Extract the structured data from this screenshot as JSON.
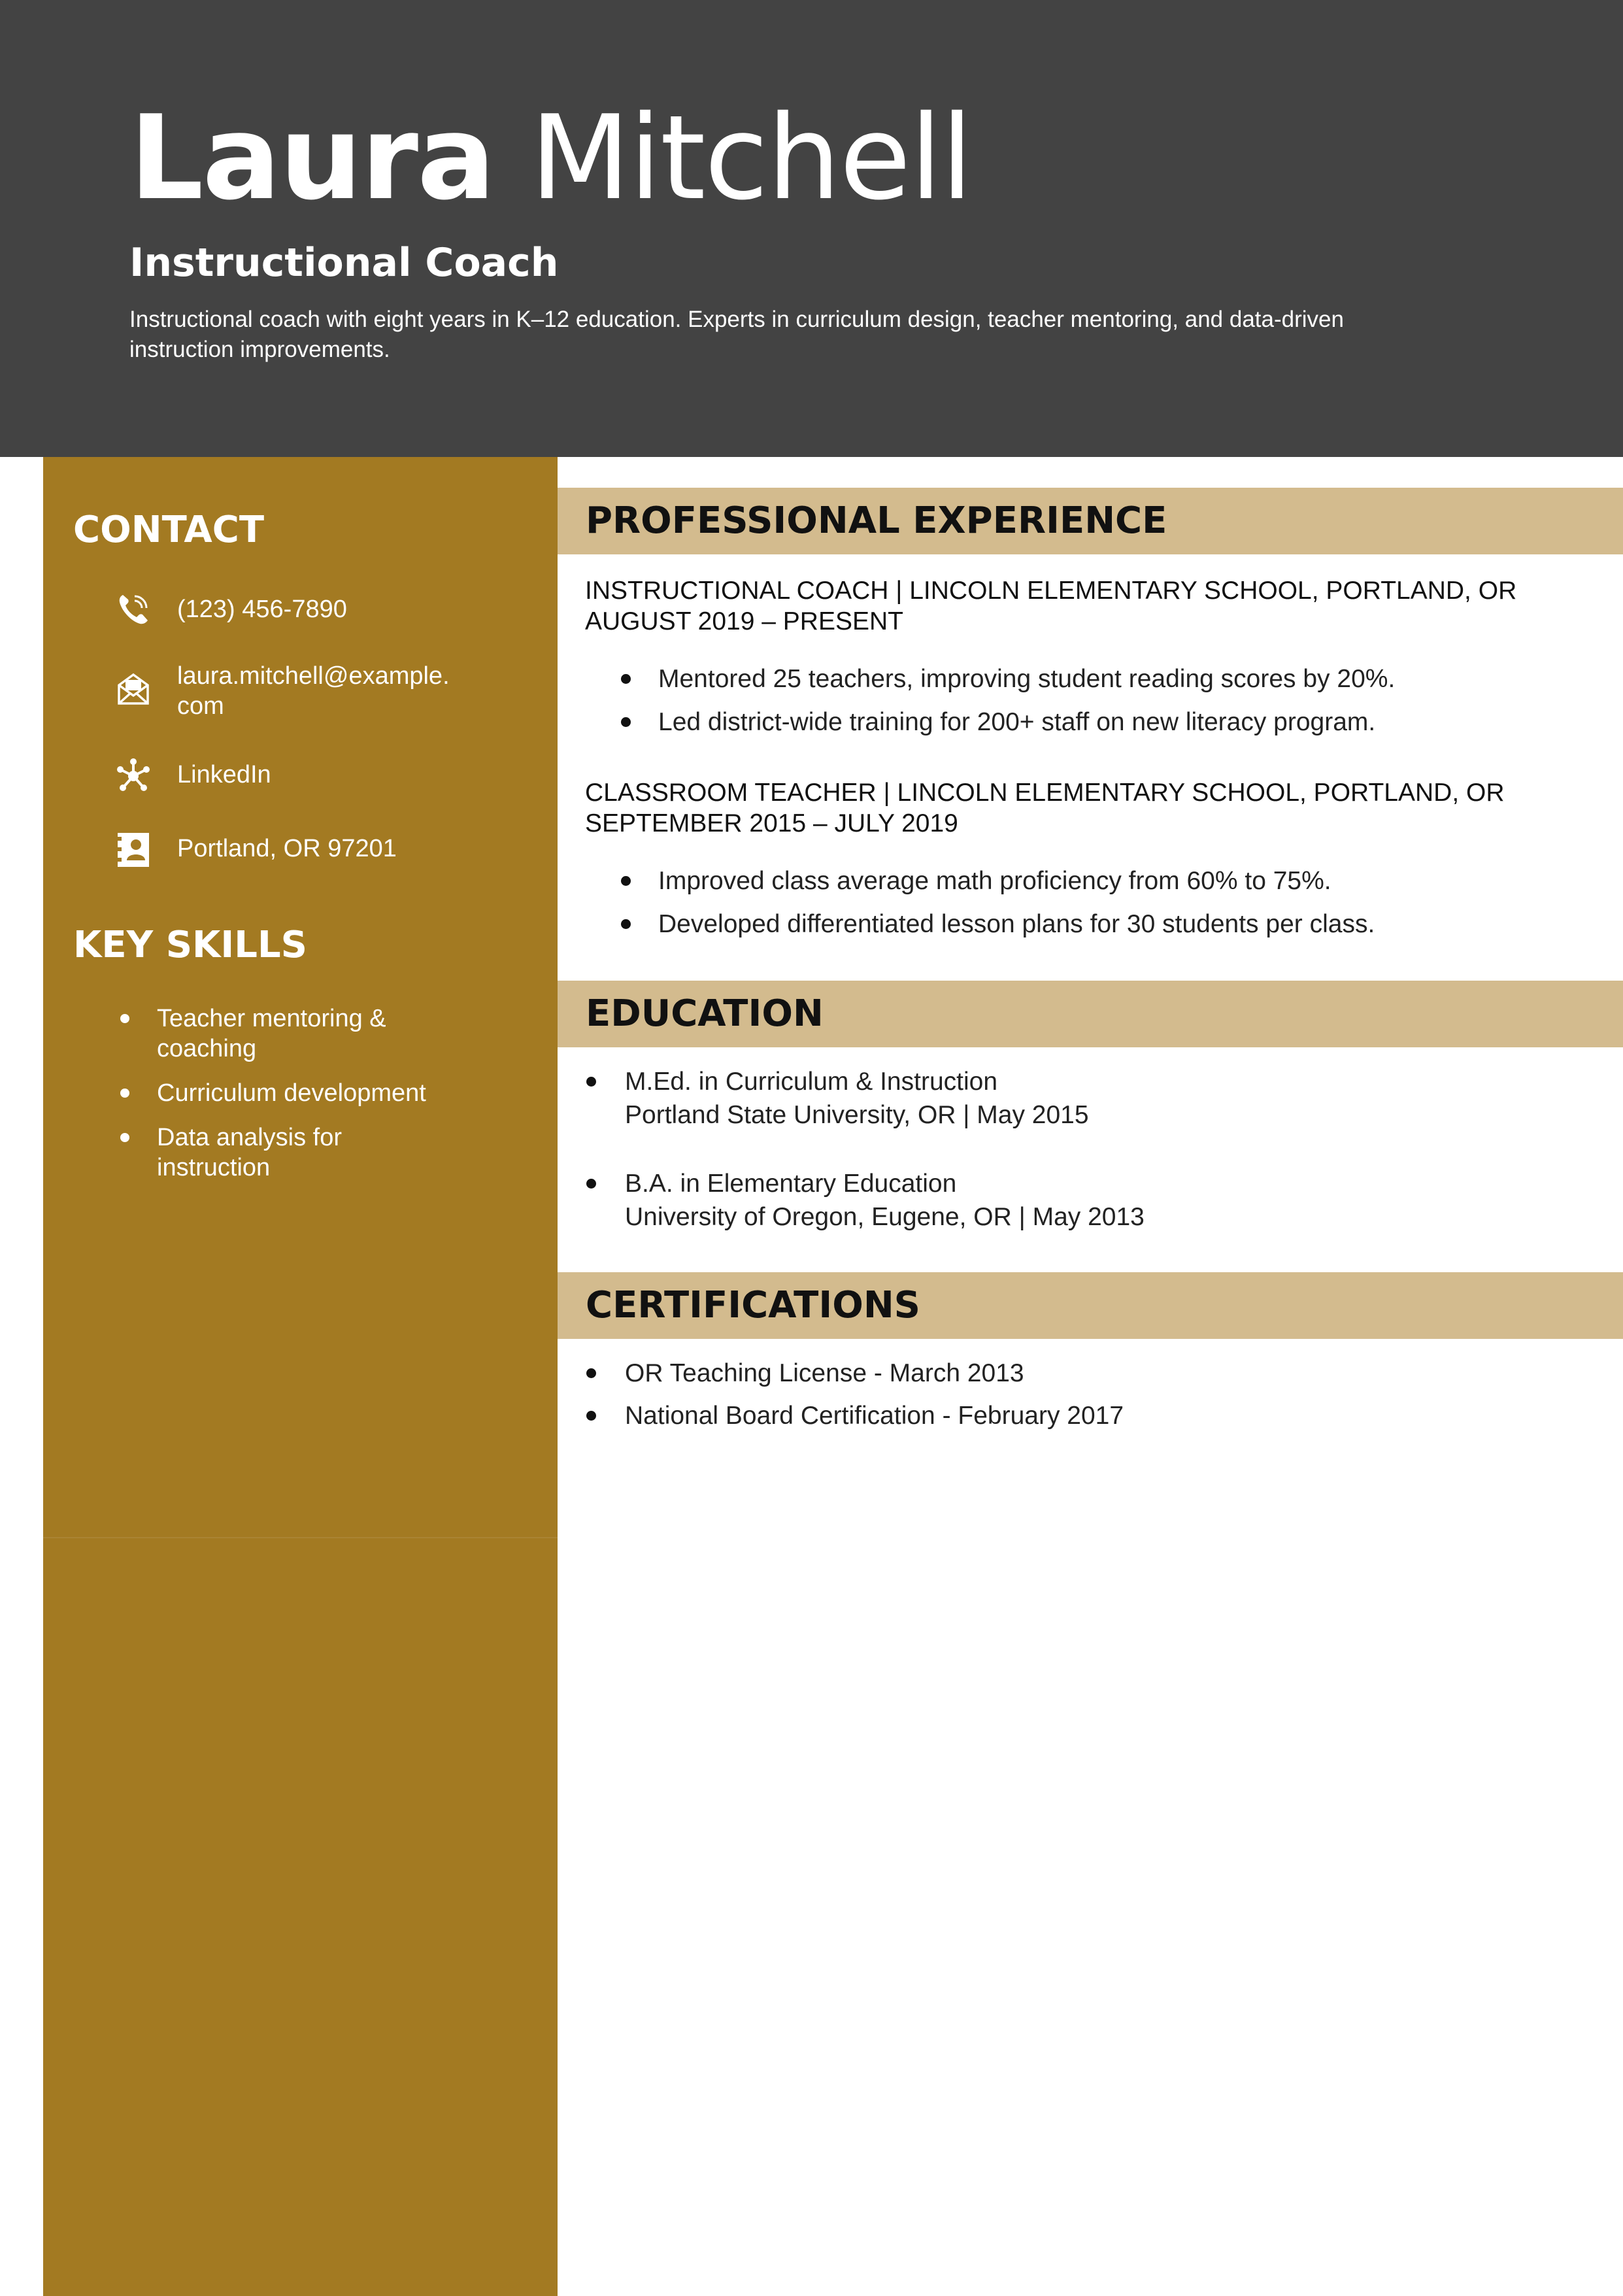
{
  "header": {
    "first_name": "Laura",
    "last_name": "Mitchell",
    "title": "Instructional Coach",
    "summary": "Instructional coach with eight years in K–12 education. Experts in curriculum design, teacher mentoring, and data-driven instruction improvements."
  },
  "sidebar": {
    "contact_heading": "CONTACT",
    "contact": [
      {
        "icon": "phone-icon",
        "text": "(123) 456-7890"
      },
      {
        "icon": "envelope-icon",
        "text": "laura.mitchell@example.com"
      },
      {
        "icon": "network-icon",
        "text": "LinkedIn"
      },
      {
        "icon": "address-card-icon",
        "text": "Portland, OR 97201"
      }
    ],
    "skills_heading": "KEY SKILLS",
    "skills": [
      "Teacher mentoring & coaching",
      "Curriculum development",
      "Data analysis for instruction"
    ]
  },
  "experience": {
    "heading": "PROFESSIONAL EXPERIENCE",
    "jobs": [
      {
        "title": "INSTRUCTIONAL COACH | LINCOLN ELEMENTARY SCHOOL, PORTLAND, OR",
        "dates": "AUGUST 2019 – PRESENT",
        "bullets": [
          "Mentored 25 teachers, improving student reading scores by 20%.",
          "Led district-wide training for 200+ staff on new literacy program."
        ]
      },
      {
        "title": "CLASSROOM TEACHER | LINCOLN ELEMENTARY SCHOOL, PORTLAND, OR",
        "dates": "SEPTEMBER 2015 – JULY 2019",
        "bullets": [
          "Improved class average math proficiency from 60% to 75%.",
          "Developed differentiated lesson plans for 30 students per class."
        ]
      }
    ]
  },
  "education": {
    "heading": "EDUCATION",
    "entries": [
      {
        "degree": "M.Ed. in Curriculum & Instruction",
        "school": "Portland State University, OR | May 2015"
      },
      {
        "degree": "B.A. in Elementary Education",
        "school": "University of Oregon, Eugene, OR | May 2013"
      }
    ]
  },
  "certifications": {
    "heading": "CERTIFICATIONS",
    "items": [
      "OR Teaching License - March 2013",
      "National Board Certification - February 2017"
    ]
  },
  "colors": {
    "header_bg": "#434343",
    "sidebar_bg": "#a37a22",
    "section_bar": "#d3bb8e"
  }
}
